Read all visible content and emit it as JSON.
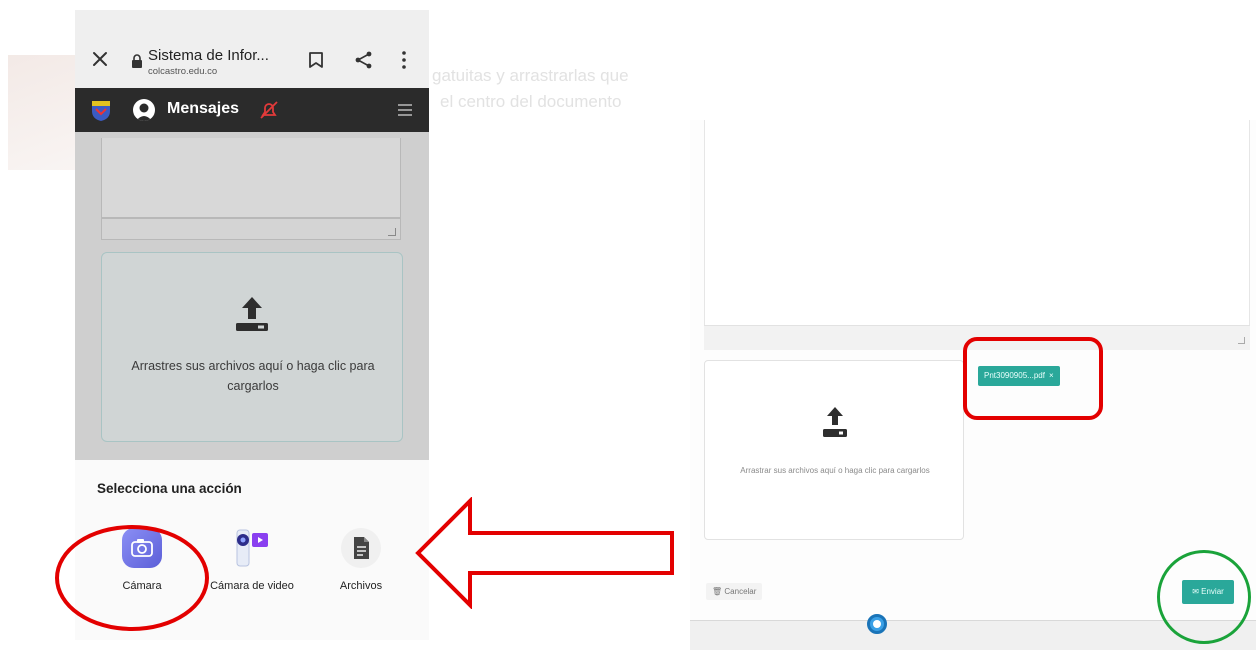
{
  "background": {
    "faded_text_line1": "gatuitas y arrastrarlas que",
    "faded_text_line2": "el centro del documento"
  },
  "browser": {
    "page_title": "Sistema de Infor...",
    "url": "colcastro.edu.co",
    "close_icon": "close-icon",
    "bookmark_icon": "bookmark-icon",
    "share_icon": "share-icon",
    "more_icon": "more-vertical-icon"
  },
  "app": {
    "title": "Mensajes",
    "logo_icon": "school-crest-icon",
    "avatar_icon": "user-avatar-icon",
    "notification_icon": "bell-off-icon",
    "menu_icon": "hamburger-menu-icon",
    "accent_red": "#e23a3a"
  },
  "upload": {
    "dropzone_text": "Arrastres sus archivos aquí o haga clic para cargarlos",
    "icon": "upload-icon"
  },
  "action_sheet": {
    "title": "Selecciona una acción",
    "actions": [
      {
        "label": "Cámara",
        "icon": "camera-icon",
        "color": "#6c6fe0"
      },
      {
        "label": "Cámara de video",
        "icon": "video-camera-icon",
        "color": "#8a3ff0"
      },
      {
        "label": "Archivos",
        "icon": "file-icon",
        "color": "#555555"
      }
    ]
  },
  "desktop_form": {
    "dropzone_text": "Arrastrar sus archivos aquí o haga clic para cargarlos",
    "file_chip": "Pnt3090905...pdf",
    "file_chip_remove": "×",
    "cancel_label": "Cancelar",
    "send_label": "Enviar",
    "accent": "#2aa89a"
  },
  "annotations": {
    "highlight_red": "#e30000",
    "highlight_green": "#1aa33a"
  }
}
